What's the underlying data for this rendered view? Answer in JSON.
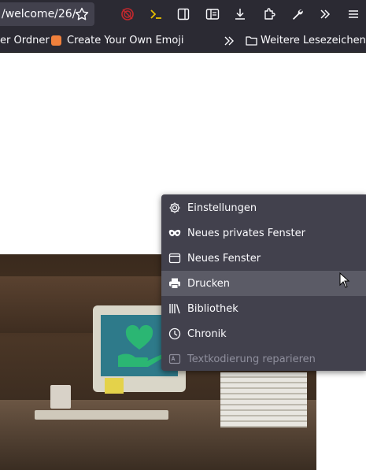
{
  "toolbar": {
    "url": "/welcome/26/",
    "icons": [
      "star-icon",
      "ublock-icon",
      "terminal-icon",
      "sidebar-icon",
      "reader-view-icon",
      "download-icon",
      "extensions-icon",
      "wrench-icon",
      "overflow-icon",
      "hamburger-menu-icon"
    ]
  },
  "bookmarks": {
    "items": [
      {
        "label": "er Ordner"
      },
      {
        "label": "Create Your Own Emoji"
      }
    ],
    "more_label": "Weitere Lesezeichen"
  },
  "menu": {
    "items": [
      {
        "label": "Einstellungen",
        "icon": "gear-icon"
      },
      {
        "label": "Neues privates Fenster",
        "icon": "mask-icon"
      },
      {
        "label": "Neues Fenster",
        "icon": "window-icon"
      },
      {
        "label": "Drucken",
        "icon": "printer-icon",
        "highlighted": true
      },
      {
        "label": "Bibliothek",
        "icon": "library-icon"
      },
      {
        "label": "Chronik",
        "icon": "clock-icon"
      },
      {
        "label": "Textkodierung reparieren",
        "icon": "text-encoding-icon",
        "disabled": true
      }
    ]
  },
  "colors": {
    "toolbar_bg": "#2b2a33",
    "menu_bg": "#42414d",
    "menu_hover": "#5b5b66",
    "logo_green": "#2bb673"
  }
}
